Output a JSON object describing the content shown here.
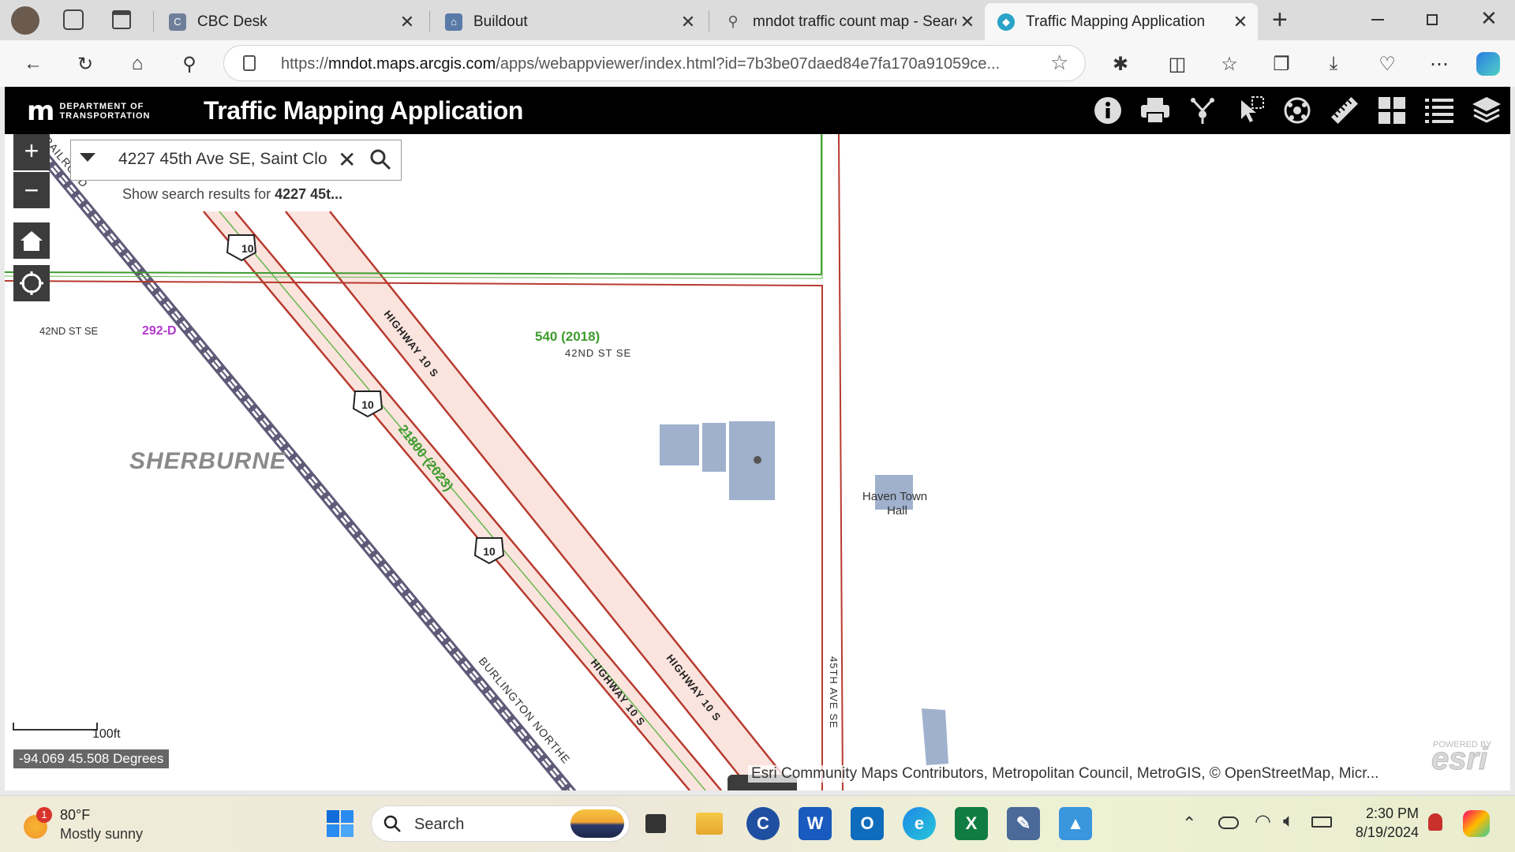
{
  "browser": {
    "tabs": [
      {
        "title": "CBC Desk",
        "active": false
      },
      {
        "title": "Buildout",
        "active": false
      },
      {
        "title": "mndot traffic count map - Searc",
        "active": false
      },
      {
        "title": "Traffic Mapping Application",
        "active": true
      }
    ],
    "url_prefix": "https://",
    "url_host": "mndot.maps.arcgis.com",
    "url_path": "/apps/webappviewer/index.html?id=7b3be07daed84e7fa170a91059ce..."
  },
  "app": {
    "logo_mark": "m",
    "logo_line1": "DEPARTMENT OF",
    "logo_line2": "TRANSPORTATION",
    "title": "Traffic Mapping Application",
    "toolbar_icons": [
      "info-icon",
      "print-icon",
      "share-icon",
      "select-icon",
      "data-icon",
      "measure-icon",
      "basemap-gallery-icon",
      "legend-icon",
      "layer-list-icon"
    ]
  },
  "search": {
    "value": "4227 45th Ave SE, Saint Clo",
    "suggest_prefix": "Show search results for ",
    "suggest_term": "4227 45t..."
  },
  "map": {
    "zoom_in": "+",
    "zoom_out": "−",
    "labels": {
      "railroad_top": "RAILROAD",
      "street_42nd_left": "42ND ST SE",
      "street_42nd_right": "42ND ST SE",
      "count_292": "292-D",
      "count_540": "540 (2018)",
      "count_21800": "21800 (2023)",
      "hwy10s_a": "HIGHWAY 10 S",
      "hwy10s_b": "HIGHWAY 10 S",
      "hwy10s_c": "HIGHWAY 10 S",
      "shield": "10",
      "county": "SHERBURNE",
      "poi_line1": "Haven Town",
      "poi_line2": "Hall",
      "ave_45th": "45TH AVE SE",
      "railroad_bottom": "BURLINGTON NORTHE"
    },
    "scale_label": "100ft",
    "coordinates": "-94.069 45.508 Degrees",
    "attribution": "Esri Community Maps Contributors, Metropolitan Council, MetroGIS, © OpenStreetMap, Micr...",
    "esri_powered": "POWERED BY",
    "esri_logo": "esri"
  },
  "taskbar": {
    "weather_badge": "1",
    "weather_temp": "80°F",
    "weather_desc": "Mostly sunny",
    "search_label": "Search",
    "time": "2:30 PM",
    "date": "8/19/2024"
  },
  "colors": {
    "highway_red": "#b83a2e",
    "highway_fill": "#fbe3de",
    "count_green": "#3f9b2f",
    "count_purple": "#b23ad1",
    "railroad": "#5e5a78",
    "building": "#9fb1cc"
  }
}
